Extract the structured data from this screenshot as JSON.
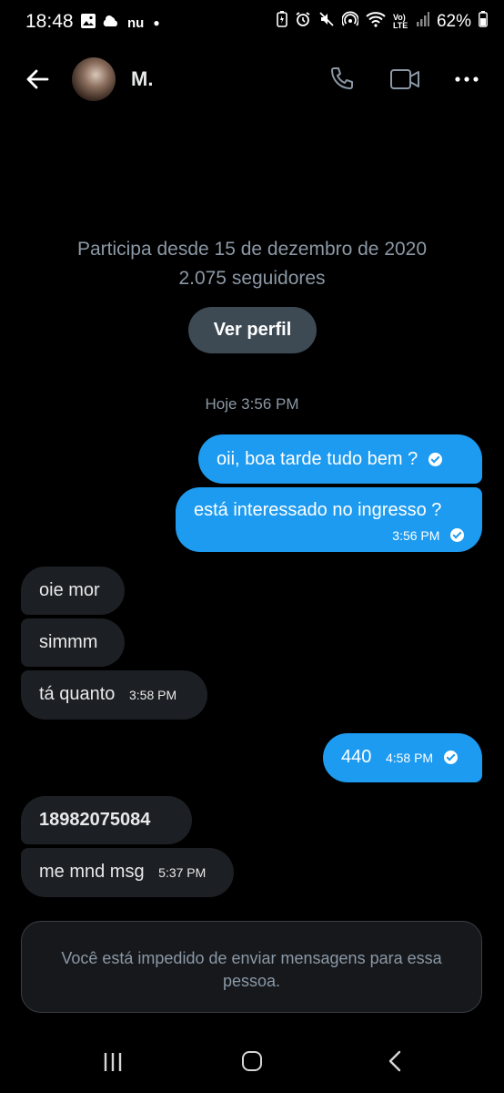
{
  "status_bar": {
    "time": "18:48",
    "carrier_badge": "nu",
    "battery": "62%",
    "network": "Vo) LTE"
  },
  "header": {
    "name": "M."
  },
  "profile": {
    "joined": "Participa desde 15 de dezembro de 2020",
    "followers": "2.075 seguidores",
    "view_profile": "Ver perfil"
  },
  "conversation": {
    "day_label": "Hoje 3:56 PM",
    "messages": [
      {
        "dir": "out",
        "text": "oii, boa tarde tudo bem ?"
      },
      {
        "dir": "out",
        "text": "está interessado no ingresso ?",
        "time": "3:56 PM"
      },
      {
        "dir": "in",
        "text": "oie mor"
      },
      {
        "dir": "in",
        "text": "simmm"
      },
      {
        "dir": "in",
        "text": "tá quanto",
        "time": "3:58 PM"
      },
      {
        "dir": "out",
        "text": "440",
        "time": "4:58 PM"
      },
      {
        "dir": "in",
        "text": "18982075084"
      },
      {
        "dir": "in",
        "text": "me mnd msg",
        "time": "5:37 PM"
      }
    ]
  },
  "composer": {
    "blocked_text": "Você está impedido de enviar mensagens para essa pessoa."
  },
  "colors": {
    "accent": "#1d9bf0",
    "incoming_bubble": "#1c1f23",
    "secondary_text": "#8b98a5"
  }
}
